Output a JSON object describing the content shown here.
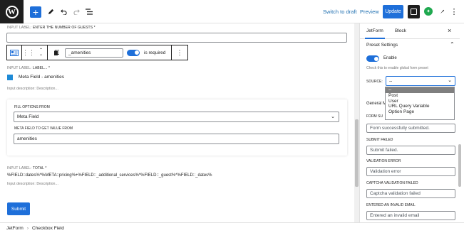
{
  "topbar": {
    "switch_draft": "Switch to draft",
    "preview": "Preview",
    "update": "Update",
    "jetform_badge": "✦"
  },
  "canvas": {
    "field1": {
      "label_prefix": "INPUT LABEL:",
      "label": "ENTER THE NUMBER OF GUESTS *"
    },
    "toolbar": {
      "input_value": "_amenities",
      "toggle_label": "is required"
    },
    "field2": {
      "label_prefix": "INPUT LABEL:",
      "label": "LABEL... *",
      "checkbox_text": "Meta Field - amenities",
      "desc_prefix": "Input description:",
      "desc": "Description..."
    },
    "fill_options": {
      "label": "FILL OPTIONS FROM",
      "value": "Meta Field",
      "meta_label": "META FIELD TO GET VALUE FROM",
      "meta_value": "amenities"
    },
    "field3": {
      "label_prefix": "INPUT LABEL:",
      "label": "TOTAL *",
      "formula": "%FIELD::dates%*%META::pricing%+%FIELD::_additional_services%*%FIELD::_guest%*%FIELD::_dates%",
      "desc_prefix": "Input description:",
      "desc": "Description..."
    },
    "submit": "Submit"
  },
  "sidebar": {
    "tabs": [
      "JetForm",
      "Block"
    ],
    "preset_title": "Preset Settings",
    "enable_label": "Enable",
    "enable_help": "Check this to enable global form preset",
    "source_label": "SOURCE:",
    "source_value": "--",
    "dropdown": [
      "--",
      "Post",
      "User",
      "URL Query Variable",
      "Option Page"
    ],
    "general_title": "General M",
    "form_success_label": "FORM SU",
    "form_success": "Form successfully submitted.",
    "submit_failed_label": "SUBMIT FAILED",
    "submit_failed": "Submit failed.",
    "validation_label": "VALIDATION ERROR",
    "validation": "Validation error",
    "captcha_label": "CAPTCHA VALIDATION FAILED",
    "captcha": "Captcha validation failed",
    "invalid_email_label": "ENTERED AN INVALID EMAIL",
    "invalid_email": "Entered an invalid email"
  },
  "status": {
    "crumb1": "JetForm",
    "sep": "›",
    "crumb2": "Checkbox Field"
  },
  "colors": {
    "accent": "#1e6fd9",
    "green": "#1fa84f"
  }
}
